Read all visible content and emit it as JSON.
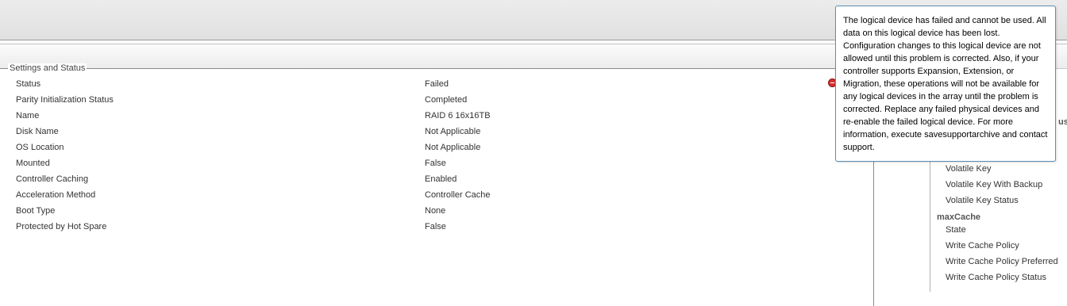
{
  "settings": {
    "legend": "Settings and Status",
    "rows": [
      {
        "label": "Status",
        "value": "Failed"
      },
      {
        "label": "Parity Initialization Status",
        "value": "Completed"
      },
      {
        "label": "Name",
        "value": "RAID 6 16x16TB"
      },
      {
        "label": "Disk Name",
        "value": "Not Applicable"
      },
      {
        "label": "OS Location",
        "value": "Not Applicable"
      },
      {
        "label": "Mounted",
        "value": "False"
      },
      {
        "label": "Controller Caching",
        "value": "Enabled"
      },
      {
        "label": "Acceleration Method",
        "value": "Controller Cache"
      },
      {
        "label": "Boot Type",
        "value": "None"
      },
      {
        "label": "Protected by Hot Spare",
        "value": "False"
      }
    ],
    "status_icon": "failed-status-icon"
  },
  "right_panel": {
    "partial_text": "us",
    "items_top": [
      "Volatile Key",
      "Volatile Key With Backup",
      "Volatile Key Status"
    ],
    "section": "maxCache",
    "items_section": [
      "State",
      "Write Cache Policy",
      "Write Cache Policy Preferred",
      "Write Cache Policy Status"
    ]
  },
  "tooltip": {
    "text": "The logical device has failed and cannot be used. All data on this logical device has been lost. Configuration changes to this logical device are not allowed until this problem is corrected. Also, if your controller supports Expansion, Extension, or Migration, these operations will not be available for any logical devices in the array until the problem is corrected. Replace any failed physical devices and re-enable the failed logical device. For more information, execute savesupportarchive and contact support."
  },
  "colors": {
    "failed": "#d23030",
    "tooltip_border": "#5b8fb3"
  }
}
